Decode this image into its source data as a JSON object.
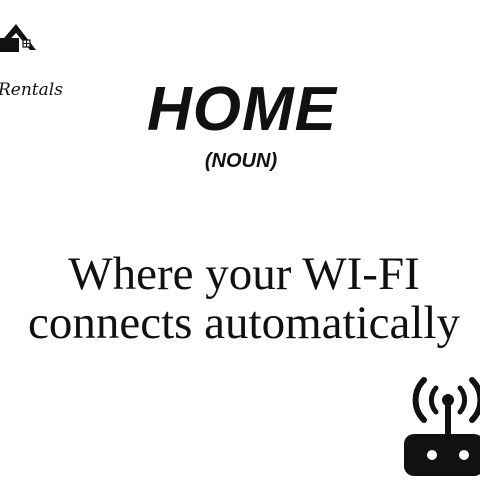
{
  "brand": {
    "logo_icon": "house-icon",
    "logo_text": "Rentals"
  },
  "entry": {
    "headword": "HOME",
    "part_of_speech": "(NOUN)",
    "definition_lines": [
      "Where your WI-FI",
      "connects automatically"
    ]
  },
  "illustration": {
    "icon": "wifi-router-icon"
  },
  "colors": {
    "background": "#ffffff",
    "ink": "#111111"
  }
}
